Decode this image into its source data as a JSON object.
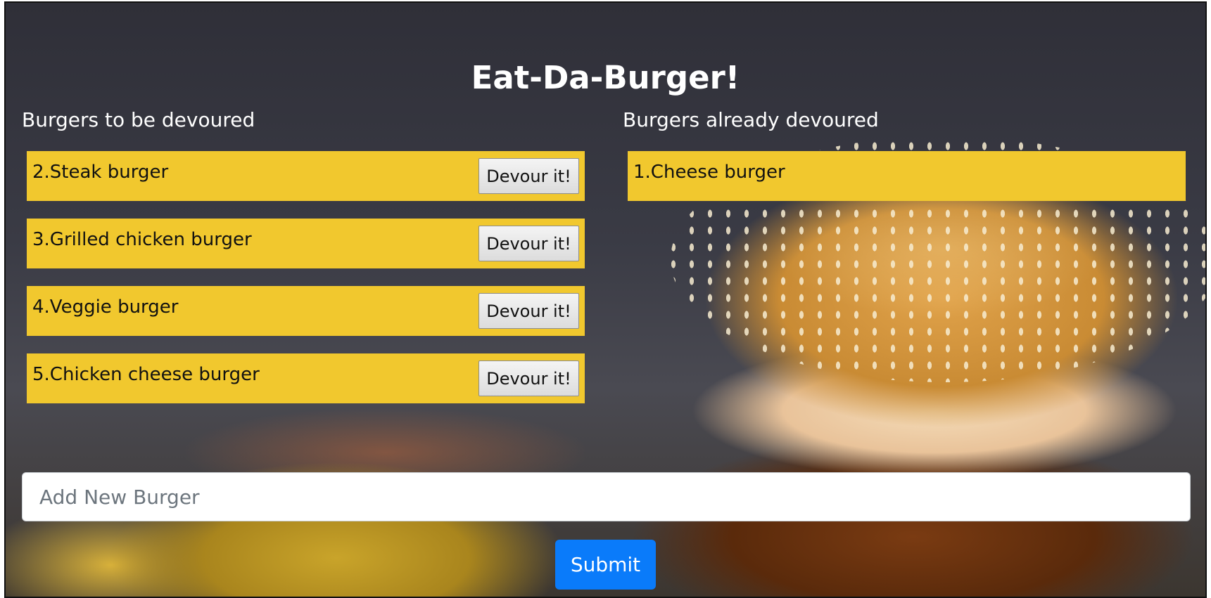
{
  "page": {
    "title": "Eat-Da-Burger!"
  },
  "columns": {
    "to_devour": {
      "heading": "Burgers to be devoured",
      "items": [
        {
          "label": "2.Steak burger",
          "button": "Devour it!"
        },
        {
          "label": "3.Grilled chicken burger",
          "button": "Devour it!"
        },
        {
          "label": "4.Veggie burger",
          "button": "Devour it!"
        },
        {
          "label": "5.Chicken cheese burger",
          "button": "Devour it!"
        }
      ]
    },
    "devoured": {
      "heading": "Burgers already devoured",
      "items": [
        {
          "label": "1.Cheese burger"
        }
      ]
    }
  },
  "form": {
    "placeholder": "Add New Burger",
    "submit_label": "Submit"
  },
  "colors": {
    "item_bg": "#f1c82e",
    "submit_bg": "#0a7bfa"
  }
}
